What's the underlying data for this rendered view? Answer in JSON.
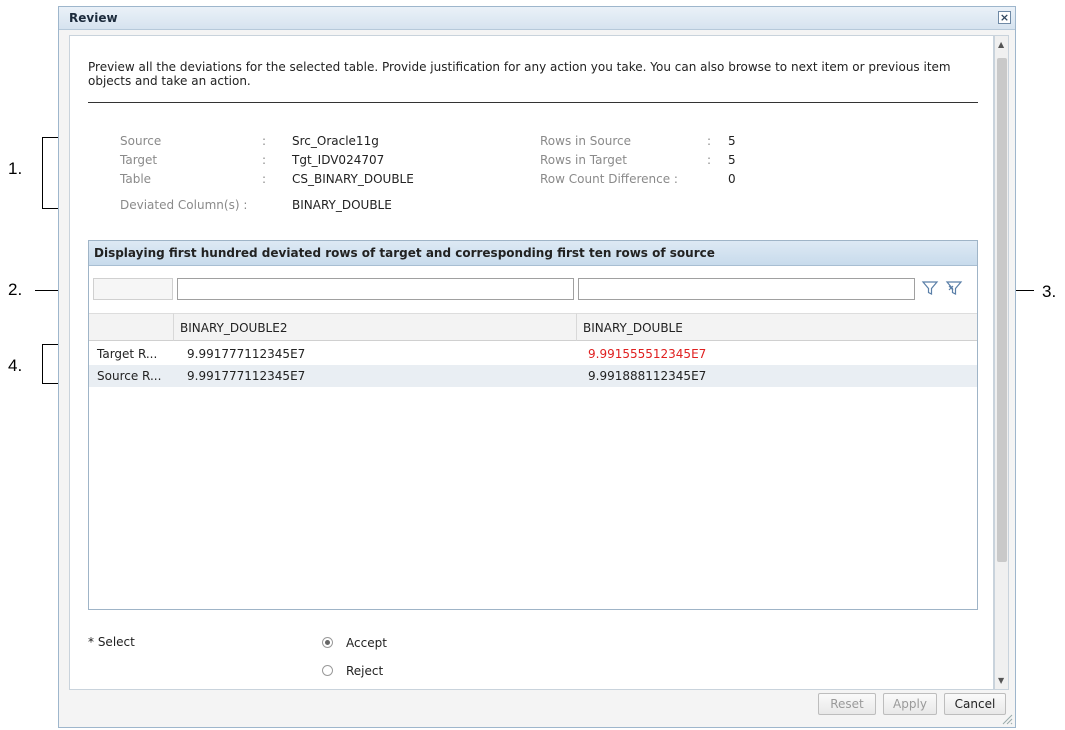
{
  "dialog": {
    "title": "Review",
    "close_glyph": "×"
  },
  "description": "Preview all the deviations for the selected table. Provide justification for any action you take. You can also browse to next item or previous item objects and take an action.",
  "info": {
    "source_label": "Source",
    "source_sep": ":",
    "source_value": "Src_Oracle11g",
    "target_label": "Target",
    "target_sep": ":",
    "target_value": "Tgt_IDV024707",
    "table_label": "Table",
    "table_sep": ":",
    "table_value": "CS_BINARY_DOUBLE",
    "deviated_label": "Deviated Column(s) :",
    "deviated_value": "BINARY_DOUBLE",
    "rows_source_label": "Rows in Source",
    "rows_source_sep": ":",
    "rows_source_value": "5",
    "rows_target_label": "Rows in Target",
    "rows_target_sep": ":",
    "rows_target_value": "5",
    "rowdiff_label": "Row Count Difference :",
    "rowdiff_value": "0"
  },
  "grid": {
    "title": "Displaying first hundred deviated rows of target and corresponding first ten rows of source",
    "columns": [
      "",
      "BINARY_DOUBLE2",
      "BINARY_DOUBLE"
    ],
    "rows": [
      {
        "label": "Target R...",
        "c1": "9.991777112345E7",
        "c2": "9.991555512345E7"
      },
      {
        "label": "Source R...",
        "c1": "9.991777112345E7",
        "c2": "9.991888112345E7"
      }
    ],
    "deviation_color": "#e02020",
    "icons": [
      "filter-icon",
      "clear-filter-icon"
    ]
  },
  "select": {
    "label": "* Select",
    "options": [
      {
        "label": "Accept",
        "selected": true
      },
      {
        "label": "Reject",
        "selected": false
      }
    ]
  },
  "buttons": {
    "reset": "Reset",
    "apply": "Apply",
    "cancel": "Cancel"
  },
  "callouts": {
    "c1": "1.",
    "c2": "2.",
    "c3": "3.",
    "c4": "4."
  }
}
